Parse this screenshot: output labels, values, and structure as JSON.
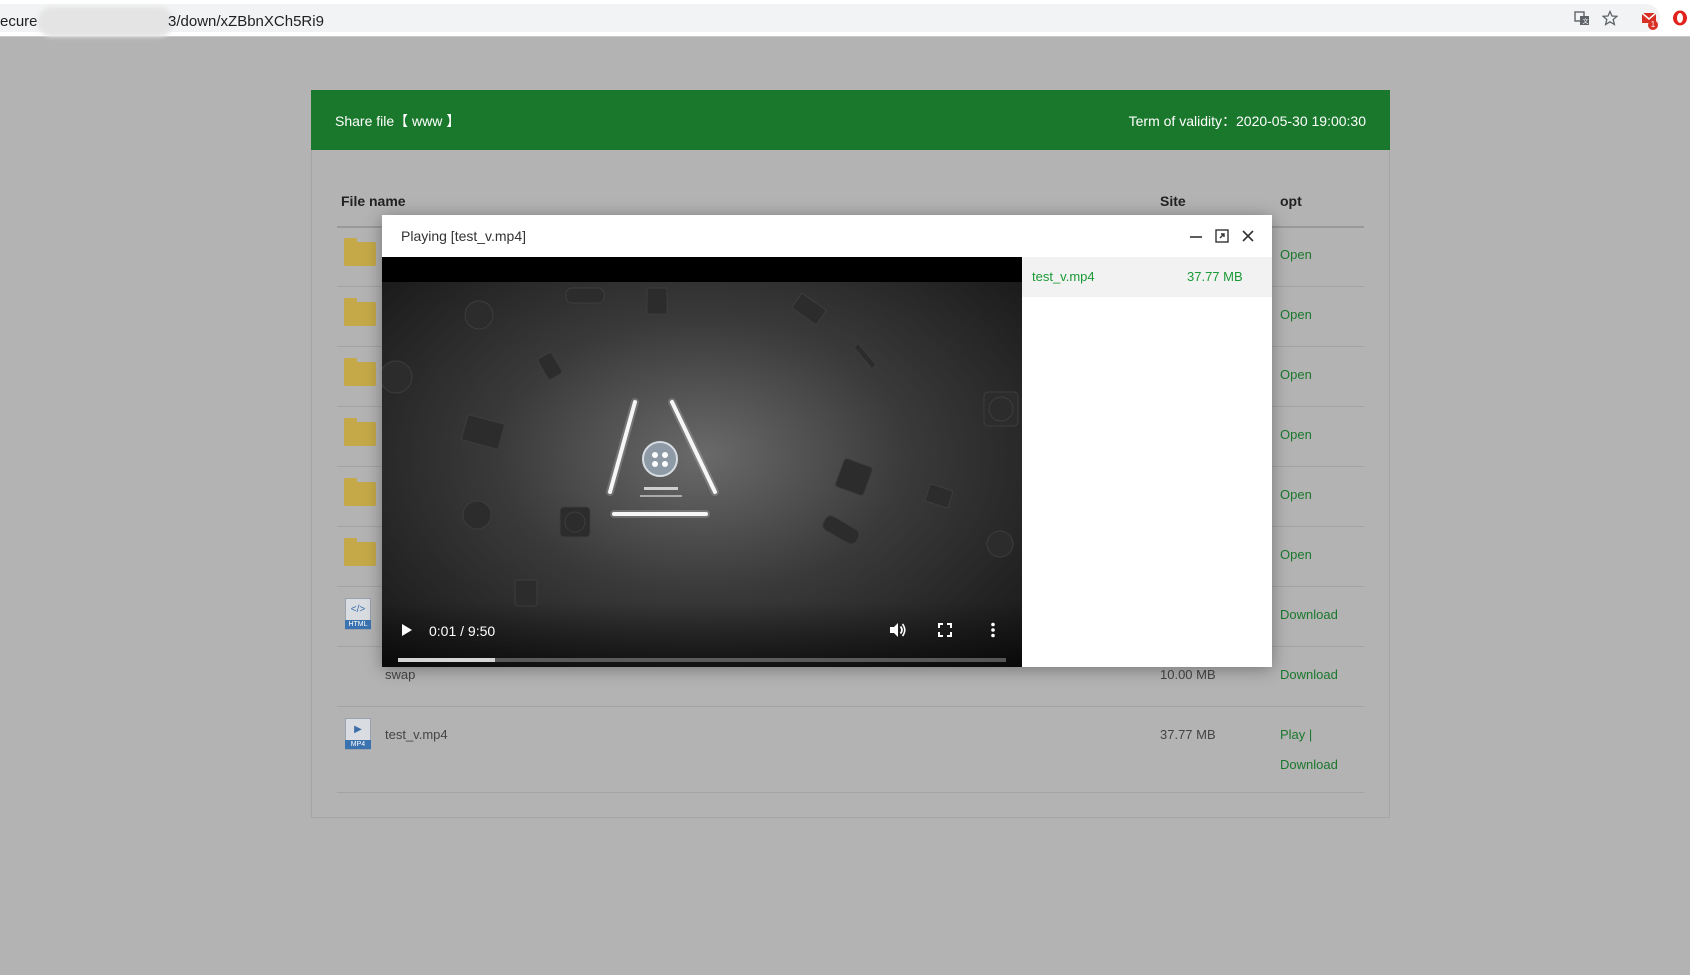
{
  "browser": {
    "url_prefix": "ecure",
    "url_path": "3/down/xZBbnXCh5Ri9",
    "gmail_badge": "1"
  },
  "share": {
    "title": "Share file【 www 】",
    "validity": "Term of validity：2020-05-30 19:00:30"
  },
  "table": {
    "columns": [
      "File name",
      "Site",
      "opt"
    ],
    "rows": [
      {
        "type": "folder",
        "name": "",
        "size": "",
        "opt": "Open"
      },
      {
        "type": "folder",
        "name": "",
        "size": "",
        "opt": "Open"
      },
      {
        "type": "folder",
        "name": "",
        "size": "",
        "opt": "Open"
      },
      {
        "type": "folder",
        "name": "",
        "size": "",
        "opt": "Open"
      },
      {
        "type": "folder",
        "name": "",
        "size": "",
        "opt": "Open"
      },
      {
        "type": "folder",
        "name": "",
        "size": "",
        "opt": "Open"
      },
      {
        "type": "html",
        "icon_tag": "HTML",
        "icon_glyph": "</>",
        "name": "",
        "size": "",
        "opt": "Download"
      },
      {
        "type": "none",
        "name": "swap",
        "size": "10.00 MB",
        "opt": "Download"
      },
      {
        "type": "mp4",
        "icon_tag": "MP4",
        "icon_glyph": "▶",
        "name": "test_v.mp4",
        "size": "37.77 MB",
        "opt": "Play |",
        "opt2": "Download"
      }
    ]
  },
  "player": {
    "title": "Playing [test_v.mp4]",
    "time": "0:01 / 9:50",
    "buffered_fraction": 0.16,
    "playlist": [
      {
        "name": "test_v.mp4",
        "size": "37.77 MB"
      }
    ]
  },
  "colors": {
    "accent": "#1a782c",
    "link": "#1a782c",
    "playlist_active": "#1a9a36"
  }
}
